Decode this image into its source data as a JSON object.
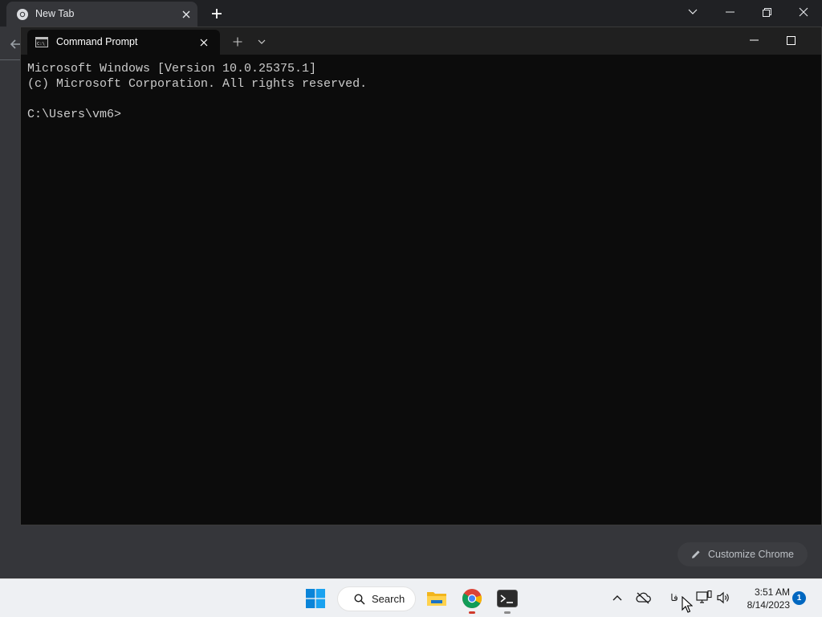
{
  "chrome": {
    "tab_title": "New Tab",
    "customize_label": "Customize Chrome"
  },
  "terminal": {
    "tab_title": "Command Prompt",
    "lines": [
      "Microsoft Windows [Version 10.0.25375.1]",
      "(c) Microsoft Corporation. All rights reserved.",
      "",
      "C:\\Users\\vm6>"
    ],
    "background_color": "#0c0c0c",
    "text_color": "#cccccc"
  },
  "taskbar": {
    "search_label": "Search",
    "ime_label": "فا",
    "time": "3:51 AM",
    "date": "8/14/2023",
    "notification_count": "1",
    "accent_color": "#0067c0"
  },
  "icons": {
    "chrome_favicon": "chrome-icon",
    "start": "windows-start-icon",
    "file_explorer": "folder-icon",
    "chrome_app": "chrome-icon",
    "terminal_app": "terminal-icon"
  }
}
